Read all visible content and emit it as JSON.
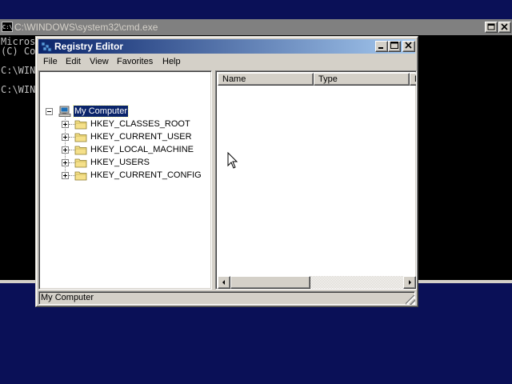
{
  "console_window": {
    "title": "C:\\WINDOWS\\system32\\cmd.exe",
    "icon_text": "C:\\",
    "lines": [
      "Micros",
      "(C) Co",
      "",
      "C:\\WIN",
      "",
      "C:\\WIN"
    ]
  },
  "regedit": {
    "title": "Registry Editor",
    "menu": [
      "File",
      "Edit",
      "View",
      "Favorites",
      "Help"
    ],
    "tree": {
      "root_label": "My Computer",
      "keys": [
        "HKEY_CLASSES_ROOT",
        "HKEY_CURRENT_USER",
        "HKEY_LOCAL_MACHINE",
        "HKEY_USERS",
        "HKEY_CURRENT_CONFIG"
      ]
    },
    "list": {
      "columns": [
        "Name",
        "Type",
        "D"
      ]
    },
    "status": "My Computer"
  },
  "colors": {
    "desktop": "#0a1057",
    "active_title_start": "#0a246a",
    "active_title_end": "#a6caf0",
    "inactive_title": "#808080",
    "face": "#d4d0c8"
  },
  "icons": [
    "console-icon",
    "registry-editor-icon",
    "computer-icon",
    "folder-icon",
    "minimize-icon",
    "maximize-icon",
    "close-icon",
    "arrow-left-icon",
    "arrow-right-icon",
    "mouse-pointer-icon"
  ]
}
